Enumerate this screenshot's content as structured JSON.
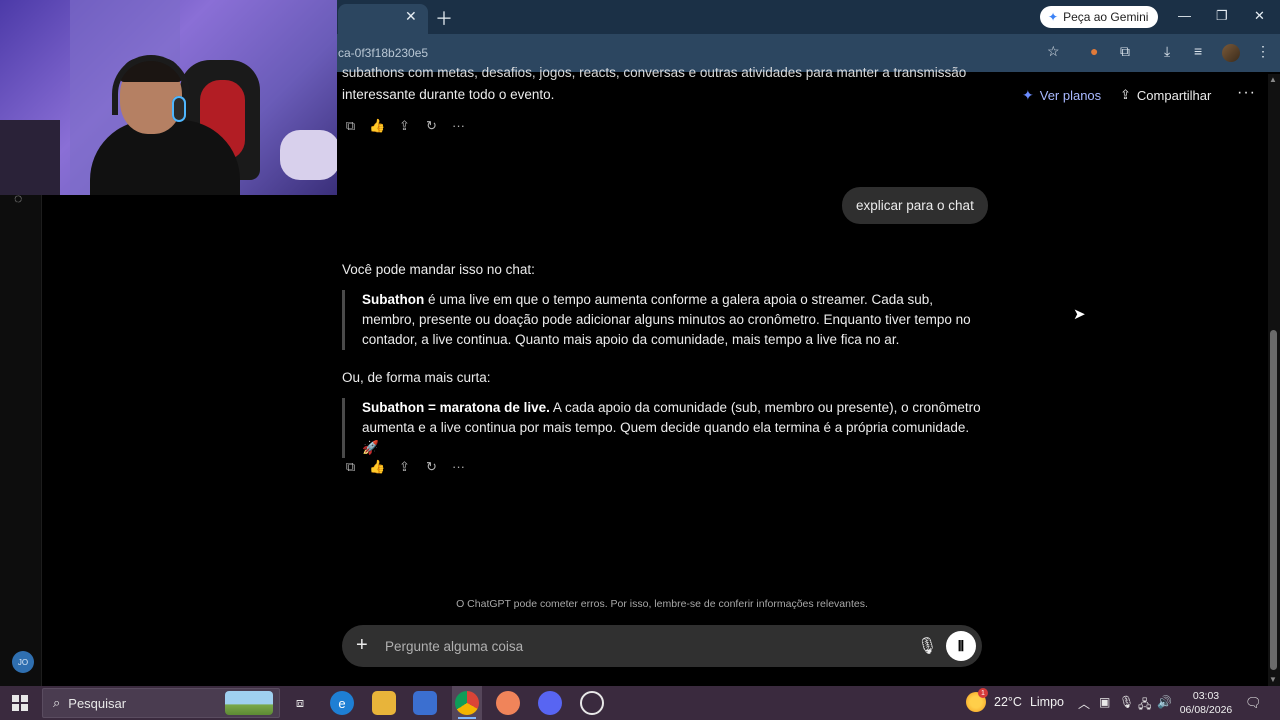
{
  "browser": {
    "url_partial": "ca-0f3f18b230e5",
    "gemini_button": "Peça ao Gemini"
  },
  "header": {
    "ver_planos": "Ver planos",
    "compartilhar": "Compartilhar"
  },
  "conversation": {
    "previous_line_1": "subathons com metas, desafios, jogos, reacts, conversas e outras atividades para manter a transmissão",
    "previous_line_2": "interessante durante todo o evento.",
    "user_message": "explicar para o chat",
    "intro": "Você pode mandar isso no chat:",
    "quote1_bold": "Subathon",
    "quote1_text": " é uma live em que o tempo aumenta conforme a galera apoia o streamer. Cada sub, membro, presente ou doação pode adicionar alguns minutos ao cronômetro. Enquanto tiver tempo no contador, a live continua. Quanto mais apoio da comunidade, mais tempo a live fica no ar.",
    "short_intro": "Ou, de forma mais curta:",
    "quote2_bold": "Subathon = maratona de live.",
    "quote2_text": " A cada apoio da comunidade (sub, membro ou presente), o cronômetro aumenta e a live continua por mais tempo. Quem decide quando ela termina é a própria comunidade. 🚀"
  },
  "composer": {
    "placeholder": "Pergunte alguma coisa",
    "disclaimer": "O ChatGPT pode cometer erros. Por isso, lembre-se de conferir informações relevantes."
  },
  "sidebar": {
    "avatar_initials": "JO"
  },
  "taskbar": {
    "search_label": "Pesquisar",
    "weather_temp": "22°C",
    "weather_condition": "Limpo",
    "weather_badge": "1",
    "time": "03:03",
    "date": "06/08/2026"
  }
}
